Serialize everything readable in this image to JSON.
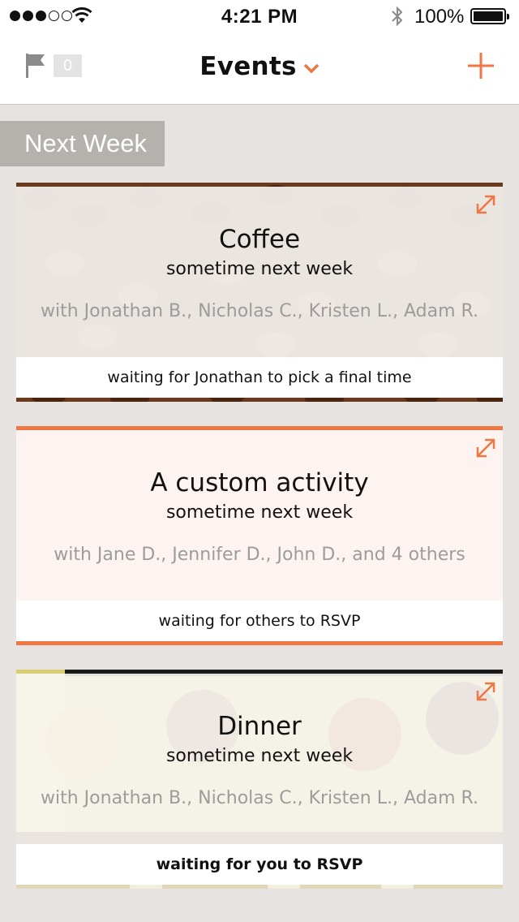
{
  "status_bar": {
    "time": "4:21 PM",
    "battery": "100%",
    "signal_dots_filled": 3,
    "signal_dots_total": 5
  },
  "nav": {
    "title": "Events",
    "flag_count": "0"
  },
  "colors": {
    "accent": "#f07644",
    "section_bg": "#b5b2ae",
    "page_bg": "#e6e3e0"
  },
  "section": {
    "label": "Next Week"
  },
  "events": [
    {
      "title": "Coffee",
      "when": "sometime next week",
      "with": "with Jonathan B., Nicholas C., Kristen L., Adam R.",
      "status": "waiting for Jonathan to pick a final time",
      "background": "coffee-beans"
    },
    {
      "title": "A custom activity",
      "when": "sometime next week",
      "with": "with Jane D., Jennifer D., John D., and 4 others",
      "status": "waiting for others to RSVP",
      "background": "plain"
    },
    {
      "title": "Dinner",
      "when": "sometime next week",
      "with": "with Jonathan B., Nicholas C., Kristen L., Adam R.",
      "status": "waiting for you to RSVP",
      "background": "dinner-illustration"
    }
  ]
}
